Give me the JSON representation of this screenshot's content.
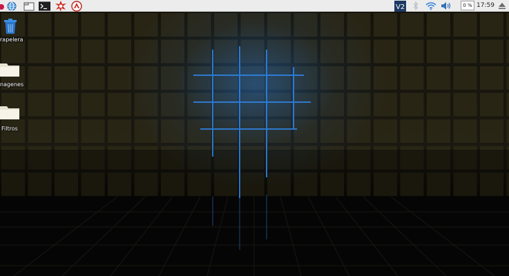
{
  "taskbar": {
    "launchers": [
      {
        "icon": "raspberry-menu-icon"
      },
      {
        "icon": "web-browser-icon"
      },
      {
        "icon": "file-manager-icon"
      },
      {
        "icon": "terminal-icon"
      },
      {
        "icon": "math-kernel-icon"
      },
      {
        "icon": "wolfram-icon"
      }
    ],
    "tray": {
      "vnc_icon": "vnc-icon",
      "bluetooth_icon": "bluetooth-icon",
      "wifi_icon": "wifi-icon",
      "volume_icon": "volume-icon",
      "cpu_usage": "0 %",
      "clock": "17:59",
      "eject_icon": "eject-icon"
    }
  },
  "desktop": {
    "icons": [
      {
        "label": "rapelera",
        "icon": "trash-icon"
      },
      {
        "label": "nagenes",
        "icon": "folder-icon"
      },
      {
        "label": "Filtros",
        "icon": "folder-icon"
      }
    ]
  },
  "colors": {
    "taskbar_bg": "#ececec",
    "wallpaper_grid": "#2b2716",
    "wallpaper_glow": "#2a7fe0"
  }
}
